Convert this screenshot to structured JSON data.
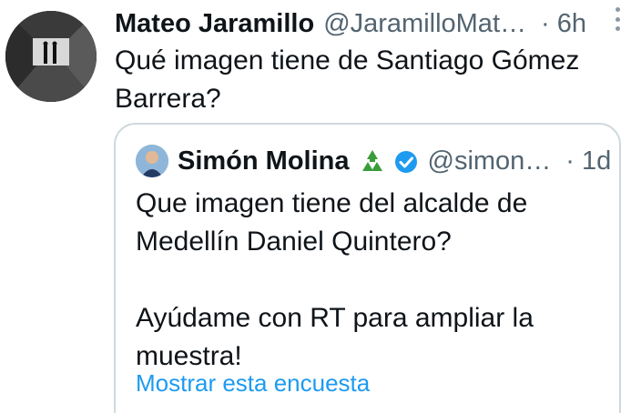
{
  "tweet": {
    "display_name": "Mateo Jaramillo",
    "handle": "@JaramilloMat…",
    "time": "· 6h",
    "text": "Qué imagen tiene de Santiago Gómez Barrera?"
  },
  "quote": {
    "display_name": "Simón Molina",
    "handle": "@simon…",
    "time": "· 1d",
    "text_line1": "Que imagen tiene del alcalde de Medellín Daniel Quintero?",
    "text_line2": "Ayúdame con RT para ampliar la muestra!",
    "poll_link": "Mostrar esta encuesta"
  },
  "icons": {
    "more": "more-vertical-icon",
    "recycle": "recycle-icon",
    "verified": "verified-badge-icon"
  },
  "colors": {
    "text": "#0f1419",
    "secondary": "#536471",
    "link": "#1d9bf0",
    "border": "#cfd9de",
    "recycle": "#3a9c3a"
  }
}
